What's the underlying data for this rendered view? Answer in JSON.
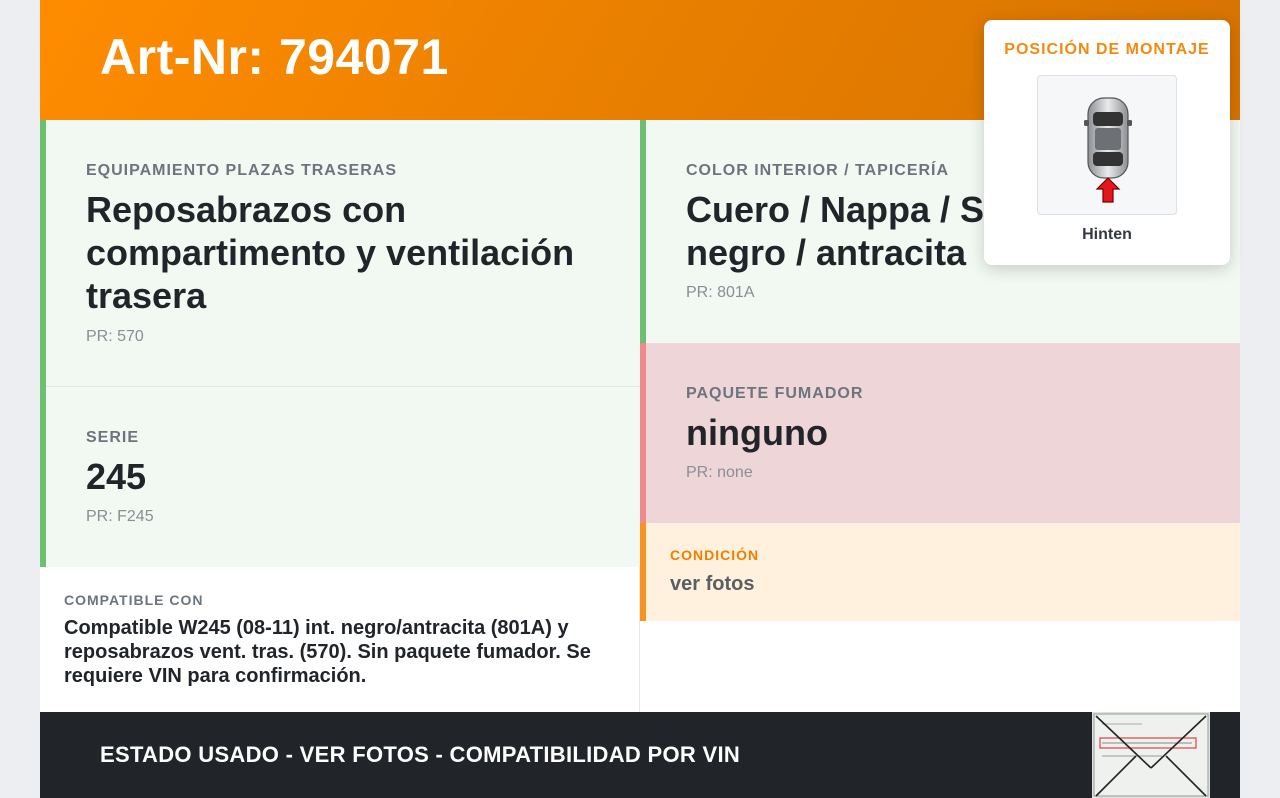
{
  "header": {
    "title": "Art-Nr: 794071"
  },
  "fields": {
    "rear_equipment": {
      "label": "EQUIPAMIENTO PLAZAS TRASERAS",
      "value": "Reposabrazos con compartimento y ventilación trasera",
      "pr": "PR: 570"
    },
    "interior_color": {
      "label": "COLOR INTERIOR / TAPICERÍA",
      "value": "Cuero / Nappa / S negro / antracita",
      "pr": "PR: 801A"
    },
    "series": {
      "label": "SERIE",
      "value": "245",
      "pr": "PR: F245"
    },
    "smoker": {
      "label": "PAQUETE FUMADOR",
      "value": "ninguno",
      "pr": "PR: none"
    }
  },
  "compatible": {
    "label": "COMPATIBLE CON",
    "text": "Compatible W245 (08-11) int. negro/antracita (801A) y reposabrazos vent. tras. (570). Sin paquete fumador. Se requiere VIN para confirmación."
  },
  "condition": {
    "label": "CONDICIÓN",
    "value": "ver fotos"
  },
  "footer": {
    "text": "ESTADO USADO - VER FOTOS - COMPATIBILIDAD POR VIN"
  },
  "mount_popup": {
    "title": "POSICIÓN DE MONTAJE",
    "caption": "Hinten",
    "icon": "car-top-view-icon"
  },
  "colors": {
    "accent": "#ff8c00",
    "green": "#6cc070",
    "red": "#f08a8a",
    "dark": "#212529"
  }
}
